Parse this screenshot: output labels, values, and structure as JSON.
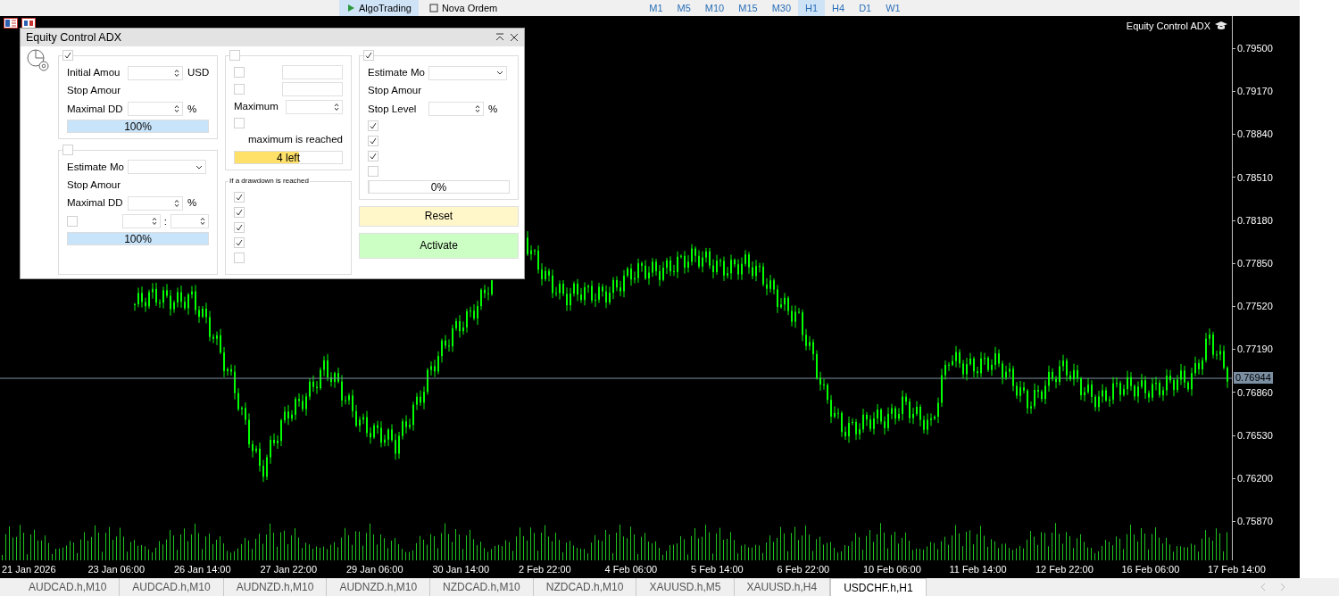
{
  "toolbar": {
    "buttons": [
      {
        "label": "AlgoTrading",
        "selected": true
      },
      {
        "label": "Nova Ordem",
        "selected": false
      }
    ],
    "timeframes": [
      {
        "label": "M1",
        "selected": false
      },
      {
        "label": "M5",
        "selected": false
      },
      {
        "label": "M10",
        "selected": false
      },
      {
        "label": "M15",
        "selected": false
      },
      {
        "label": "M30",
        "selected": false
      },
      {
        "label": "H1",
        "selected": true
      },
      {
        "label": "H4",
        "selected": false
      },
      {
        "label": "D1",
        "selected": false
      },
      {
        "label": "W1",
        "selected": false
      }
    ]
  },
  "chart": {
    "indicator_label": "Equity Control ADX",
    "price_axis": [
      "0.79500",
      "0.79170",
      "0.78840",
      "0.78510",
      "0.78180",
      "0.77850",
      "0.77520",
      "0.77190",
      "0.76860",
      "0.76530",
      "0.76200",
      "0.75870"
    ],
    "current_price": "0.76944",
    "time_axis": [
      "21 Jan 2026",
      "23 Jan 06:00",
      "26 Jan 14:00",
      "27 Jan 22:00",
      "29 Jan 06:00",
      "30 Jan 14:00",
      "2 Feb 22:00",
      "4 Feb 06:00",
      "5 Feb 14:00",
      "6 Feb 22:00",
      "10 Feb 06:00",
      "11 Feb 14:00",
      "12 Feb 22:00",
      "16 Feb 06:00",
      "17 Feb 14:00"
    ]
  },
  "dialog": {
    "title": "Equity Control ADX",
    "columns": [
      [
        {
          "header": {
            "kind": "checkbox",
            "checked": true
          },
          "rows": [
            {
              "kind": "spin_field",
              "label": "Initial Amou",
              "unit": "USD"
            },
            {
              "kind": "text",
              "label": "Stop Amour"
            },
            {
              "kind": "spin_field",
              "label": "Maximal DD",
              "unit": "%"
            },
            {
              "kind": "progress",
              "level": 1,
              "label": "100%",
              "color": "#c8e4fa"
            }
          ]
        },
        {
          "header": {
            "kind": "checkbox",
            "checked": false
          },
          "rows": [
            {
              "kind": "dropdown_field",
              "label": "Estimate Mo"
            },
            {
              "kind": "text",
              "label": "Stop Amour"
            },
            {
              "kind": "spin_field",
              "label": "Maximal DD",
              "unit": "%"
            },
            {
              "kind": "timepair",
              "checked": false,
              "separator": ":"
            },
            {
              "kind": "progress",
              "level": 1,
              "label": "100%",
              "color": "#c8e4fa"
            }
          ]
        }
      ],
      [
        {
          "header": {
            "kind": "checkbox",
            "checked": false
          },
          "rows": [
            {
              "kind": "checkfield",
              "checked": false
            },
            {
              "kind": "checkfield",
              "checked": false
            },
            {
              "kind": "spin_field",
              "label": "Maximum"
            },
            {
              "kind": "checkbox",
              "checked": false
            },
            {
              "kind": "note",
              "label": "maximum is reached"
            },
            {
              "kind": "progress",
              "level": 0.6,
              "label": "4 left",
              "color": "#ffe169"
            }
          ]
        },
        {
          "header": {
            "kind": "caption",
            "label": "If a drawdown is reached"
          },
          "rows": [
            {
              "kind": "checkbox",
              "checked": true
            },
            {
              "kind": "checkbox",
              "checked": true
            },
            {
              "kind": "checkbox",
              "checked": true
            },
            {
              "kind": "checkbox",
              "checked": true
            },
            {
              "kind": "checkbox",
              "checked": false
            }
          ]
        }
      ],
      [
        {
          "header": {
            "kind": "checkbox",
            "checked": true
          },
          "rows": [
            {
              "kind": "dropdown_field",
              "label": "Estimate Mo"
            },
            {
              "kind": "text",
              "label": "Stop Amour"
            },
            {
              "kind": "spin_field",
              "label": "Stop Level",
              "unit": "%"
            },
            {
              "kind": "checkbox",
              "checked": true
            },
            {
              "kind": "checkbox",
              "checked": true
            },
            {
              "kind": "checkbox",
              "checked": true
            },
            {
              "kind": "checkbox",
              "checked": false
            },
            {
              "kind": "progress",
              "level": 0,
              "label": "0%"
            }
          ]
        }
      ]
    ],
    "buttons": [
      {
        "label": "Reset",
        "color": "#fff6c9"
      },
      {
        "label": "Activate",
        "color": "#ccffc4"
      }
    ]
  },
  "symbol_tabs": [
    {
      "label": "AUDCAD.h,M10",
      "selected": false
    },
    {
      "label": "AUDCAD.h,M10",
      "selected": false
    },
    {
      "label": "AUDNZD.h,M10",
      "selected": false
    },
    {
      "label": "AUDNZD.h,M10",
      "selected": false
    },
    {
      "label": "NZDCAD.h,M10",
      "selected": false
    },
    {
      "label": "NZDCAD.h,M10",
      "selected": false
    },
    {
      "label": "XAUUSD.h,M5",
      "selected": false
    },
    {
      "label": "XAUUSD.h,H4",
      "selected": false
    },
    {
      "label": "USDCHF.h,H1",
      "selected": true
    }
  ]
}
